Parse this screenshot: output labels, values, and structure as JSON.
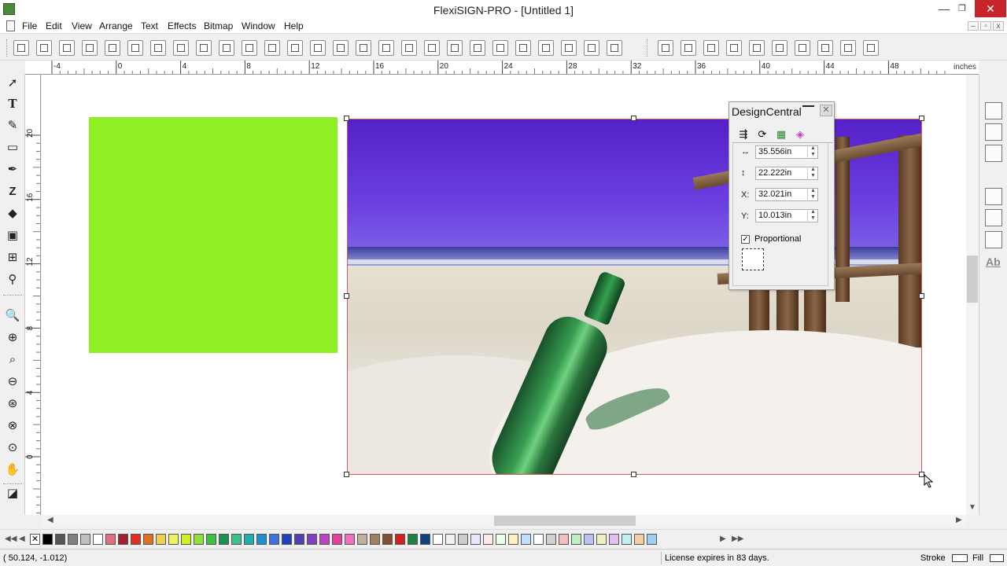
{
  "window": {
    "title": "FlexiSIGN-PRO - [Untitled 1]",
    "minimize": "—",
    "maximize": "❐",
    "close": "✕"
  },
  "menu": [
    "File",
    "Edit",
    "View",
    "Arrange",
    "Text",
    "Effects",
    "Bitmap",
    "Window",
    "Help"
  ],
  "mdi_controls": [
    "–",
    "▫",
    "x"
  ],
  "ruler": {
    "unit": "inches",
    "top_ticks": [
      "-4",
      "0",
      "4",
      "8",
      "12",
      "16",
      "20",
      "24",
      "28",
      "32",
      "36",
      "40",
      "44",
      "48"
    ],
    "left_ticks": [
      "20",
      "16",
      "12",
      "8",
      "4",
      "0"
    ]
  },
  "design_central": {
    "title": "DesignCentral",
    "tabs": [
      "transform-icon",
      "rotate-icon",
      "fill-icon",
      "color-icon"
    ],
    "width": "35.556in",
    "height": "22.222in",
    "x_label": "X:",
    "x": "32.021in",
    "y_label": "Y:",
    "y": "10.013in",
    "proportional_label": "Proportional",
    "proportional_checked": "✓",
    "width_icon": "↔",
    "height_icon": "↕"
  },
  "palette_colors": [
    "#000000",
    "#555555",
    "#808080",
    "#c0c0c0",
    "#ffffff",
    "#e07080",
    "#a02030",
    "#e03020",
    "#e07020",
    "#f0d050",
    "#f0f060",
    "#d0f020",
    "#90e040",
    "#40c040",
    "#209050",
    "#40c090",
    "#20b0b0",
    "#2090d0",
    "#4070e0",
    "#2040c0",
    "#5040b0",
    "#8040c0",
    "#c040c0",
    "#e040a0",
    "#f070c0",
    "#c0b0a0",
    "#a08060",
    "#805030",
    "#d02020",
    "#208040",
    "#104080"
  ],
  "status": {
    "coords": "( 50.124,    -1.012)",
    "license": "License expires in 83 days.",
    "stroke": "Stroke",
    "fill": "Fill"
  },
  "colors": {
    "accent_green": "#8ef023",
    "selection_border": "#d25a5a",
    "close_red": "#c7252b"
  }
}
